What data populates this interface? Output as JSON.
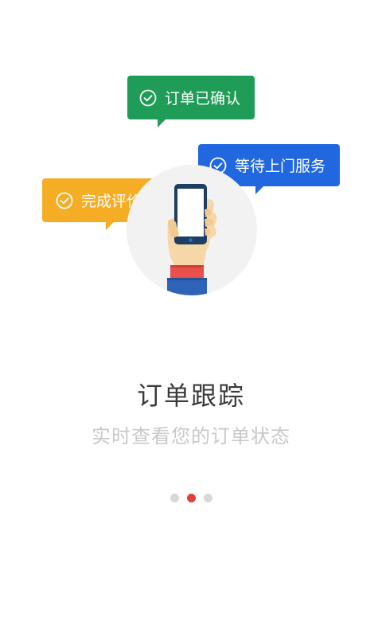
{
  "onboarding": {
    "bubbles": {
      "confirmed": "订单已确认",
      "waiting": "等待上门服务",
      "review": "完成评价"
    },
    "title": "订单跟踪",
    "subtitle": "实时查看您的订单状态"
  },
  "pager": {
    "total_pages": 3,
    "active_page": 2
  },
  "colors": {
    "green": "#1f9c57",
    "blue": "#2167e0",
    "orange": "#f5ad25",
    "active_dot": "#e0413b"
  },
  "icons": [
    "check-circle-icon",
    "phone-in-hand-illustration"
  ]
}
